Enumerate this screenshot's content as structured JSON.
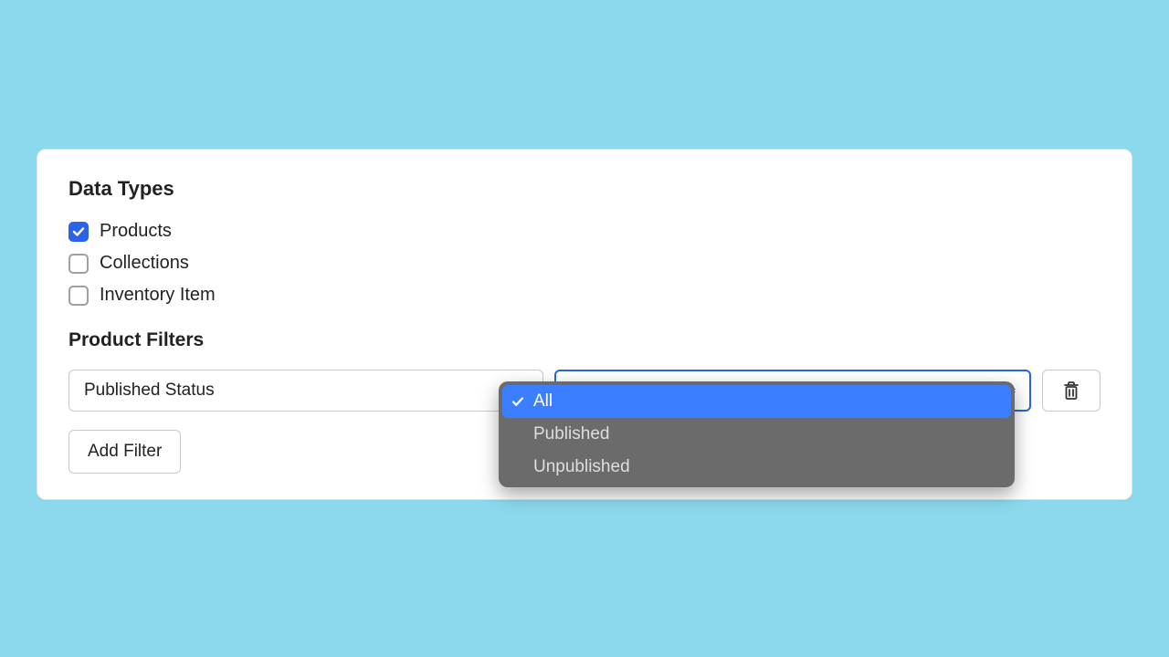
{
  "sections": {
    "data_types_title": "Data Types",
    "product_filters_title": "Product Filters"
  },
  "data_types": {
    "items": [
      {
        "label": "Products",
        "checked": true
      },
      {
        "label": "Collections",
        "checked": false
      },
      {
        "label": "Inventory Item",
        "checked": false
      }
    ]
  },
  "filter_row": {
    "field_label": "Published Status",
    "value_label": "All"
  },
  "dropdown": {
    "options": [
      {
        "label": "All",
        "selected": true
      },
      {
        "label": "Published",
        "selected": false
      },
      {
        "label": "Unpublished",
        "selected": false
      }
    ]
  },
  "buttons": {
    "add_filter": "Add Filter"
  }
}
